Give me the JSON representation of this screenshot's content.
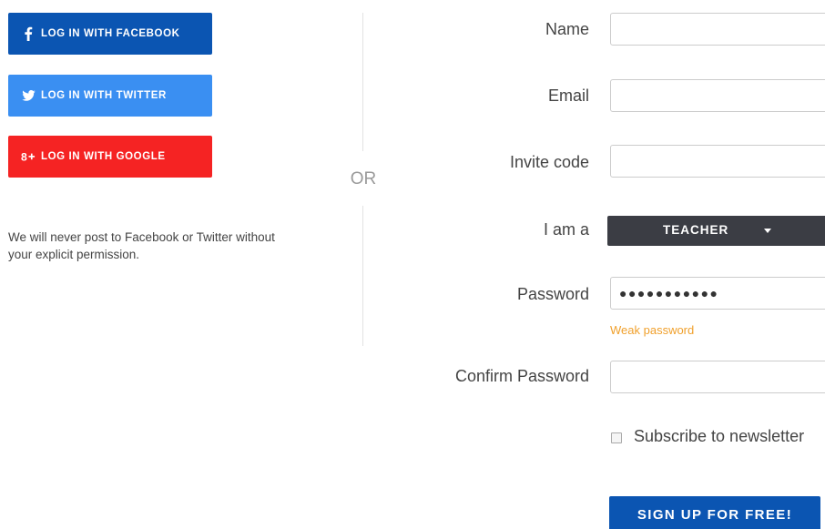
{
  "social": {
    "facebook": {
      "label": "LOG IN WITH FACEBOOK",
      "icon": "facebook-icon",
      "color": "#0b55b2"
    },
    "twitter": {
      "label": "LOG IN WITH TWITTER",
      "icon": "twitter-icon",
      "color": "#3a8ff2"
    },
    "google": {
      "label": "LOG IN WITH GOOGLE",
      "icon": "google-plus-icon",
      "color": "#f52323"
    },
    "disclaimer": "We will never post to Facebook or Twitter without your explicit permission."
  },
  "divider": {
    "or_label": "OR"
  },
  "form": {
    "name": {
      "label": "Name",
      "value": ""
    },
    "email": {
      "label": "Email",
      "value": ""
    },
    "invite": {
      "label": "Invite code",
      "value": ""
    },
    "role": {
      "label": "I am a",
      "selected": "TEACHER"
    },
    "password": {
      "label": "Password",
      "masked_value": "●●●●●●●●●●●",
      "strength": "Weak password",
      "strength_color": "#f0a02c"
    },
    "confirm": {
      "label": "Confirm Password",
      "value": ""
    },
    "newsletter": {
      "label": "Subscribe to newsletter",
      "checked": false
    },
    "submit": {
      "label": "SIGN UP FOR FREE!",
      "color": "#0b55b2"
    }
  }
}
